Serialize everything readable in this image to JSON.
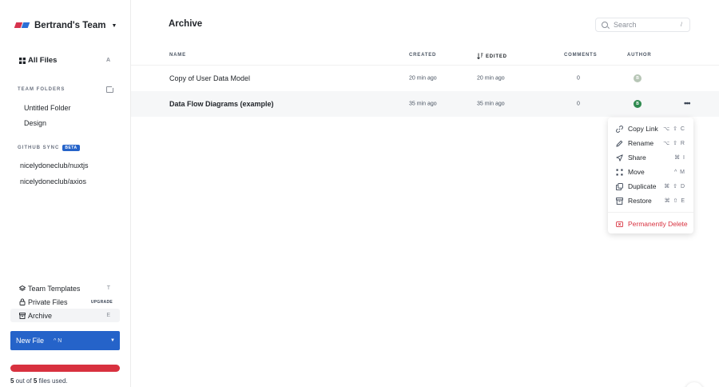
{
  "sidebar": {
    "team_name": "Bertrand's Team",
    "all_files": {
      "label": "All Files",
      "key": "A"
    },
    "team_folders_title": "TEAM FOLDERS",
    "team_folders": [
      "Untitled Folder",
      "Design"
    ],
    "github_title": "GITHUB SYNC",
    "github_badge": "BETA",
    "repos": [
      "nicelydoneclub/nuxtjs",
      "nicelydoneclub/axios"
    ],
    "bottom": {
      "templates": {
        "label": "Team Templates",
        "key": "T"
      },
      "private": {
        "label": "Private Files",
        "badge": "UPGRADE"
      },
      "archive": {
        "label": "Archive",
        "key": "E"
      }
    },
    "new_file": {
      "label": "New File",
      "shortcut": "^ N"
    },
    "usage": {
      "used": "5",
      "mid": " out of ",
      "total": "5",
      "suffix": " files used.",
      "fraction": 1.0
    }
  },
  "main": {
    "title": "Archive",
    "search": {
      "placeholder": "Search",
      "shortcut": "/"
    },
    "columns": {
      "name": "NAME",
      "created": "CREATED",
      "edited": "EDITED",
      "comments": "COMMENTS",
      "author": "AUTHOR"
    },
    "rows": [
      {
        "name": "Copy of User Data Model",
        "created": "20 min ago",
        "edited": "20 min ago",
        "comments": "0",
        "author_initial": "B",
        "author_color": "#b7c6b6"
      },
      {
        "name": "Data Flow Diagrams (example)",
        "created": "35 min ago",
        "edited": "35 min ago",
        "comments": "0",
        "author_initial": "B",
        "author_color": "#2f8a4f"
      }
    ],
    "more_glyph": "•••"
  },
  "context_menu": {
    "items": [
      {
        "label": "Copy Link",
        "shortcut": "⌥ ⇧ C",
        "icon": "link-icon"
      },
      {
        "label": "Rename",
        "shortcut": "⌥ ⇧ R",
        "icon": "pencil-icon"
      },
      {
        "label": "Share",
        "shortcut": "⌘  I",
        "icon": "send-icon"
      },
      {
        "label": "Move",
        "shortcut": "^  M",
        "icon": "move-icon"
      },
      {
        "label": "Duplicate",
        "shortcut": "⌘ ⇧ D",
        "icon": "duplicate-icon"
      },
      {
        "label": "Restore",
        "shortcut": "⌘ ⇧ E",
        "icon": "archive-box-icon"
      }
    ],
    "danger": {
      "label": "Permanently Delete",
      "icon": "delete-icon"
    }
  },
  "colors": {
    "accent": "#2563c9",
    "danger": "#d8313f",
    "logo_red": "#d6334e",
    "logo_blue": "#2b6fd6"
  }
}
